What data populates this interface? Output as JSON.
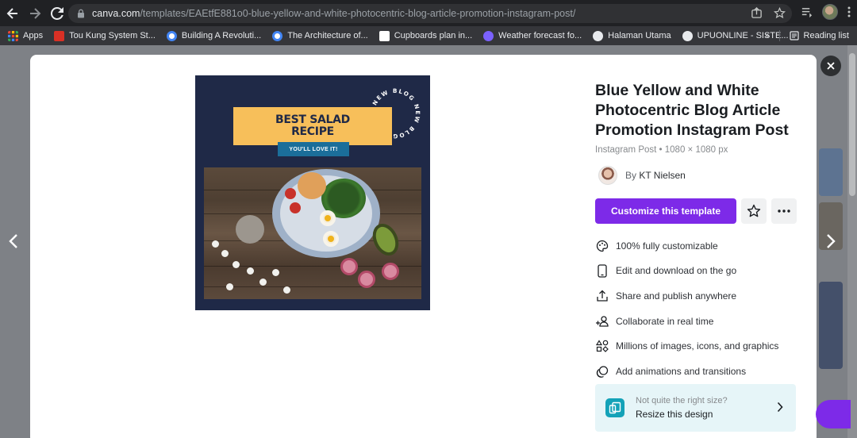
{
  "browser": {
    "url_domain": "canva.com",
    "url_path": "/templates/EAEtfE881o0-blue-yellow-and-white-photocentric-blog-article-promotion-instagram-post/"
  },
  "bookmarks": [
    {
      "label": "Apps",
      "color": "#e94235"
    },
    {
      "label": "Tou Kung System St...",
      "color": "#d93025"
    },
    {
      "label": "Building A Revoluti...",
      "color": "#4285f4"
    },
    {
      "label": "The Architecture of...",
      "color": "#4285f4"
    },
    {
      "label": "Cupboards plan in...",
      "color": "#ffffff"
    },
    {
      "label": "Weather forecast fo...",
      "color": "#7b61ff"
    },
    {
      "label": "Halaman Utama",
      "color": "#e8eaed"
    },
    {
      "label": "UPUONLINE - SISTE...",
      "color": "#e8eaed"
    }
  ],
  "bookmarks_overflow": "»",
  "reading_list": "Reading list",
  "template_preview": {
    "headline_line1": "BEST SALAD",
    "headline_line2": "RECIPE",
    "subtag": "YOU'LL LOVE IT!",
    "circle_text": "NEW BLOG NEW BLOG"
  },
  "template": {
    "title": "Blue Yellow and White Photocentric Blog Article Promotion Instagram Post",
    "meta": "Instagram Post • 1080 × 1080 px",
    "by_prefix": "By",
    "author": "KT Nielsen",
    "cta_label": "Customize this template"
  },
  "features": [
    {
      "icon": "palette-icon",
      "label": "100% fully customizable"
    },
    {
      "icon": "phone-icon",
      "label": "Edit and download on the go"
    },
    {
      "icon": "share-icon",
      "label": "Share and publish anywhere"
    },
    {
      "icon": "collaborate-icon",
      "label": "Collaborate in real time"
    },
    {
      "icon": "elements-icon",
      "label": "Millions of images, icons, and graphics"
    },
    {
      "icon": "animation-icon",
      "label": "Add animations and transitions"
    }
  ],
  "resize": {
    "question": "Not quite the right size?",
    "action": "Resize this design"
  },
  "colors": {
    "accent": "#7d2ae8",
    "preview_navy": "#1f2947",
    "preview_yellow": "#f7bf5a",
    "resize_teal": "#14a2b8"
  }
}
